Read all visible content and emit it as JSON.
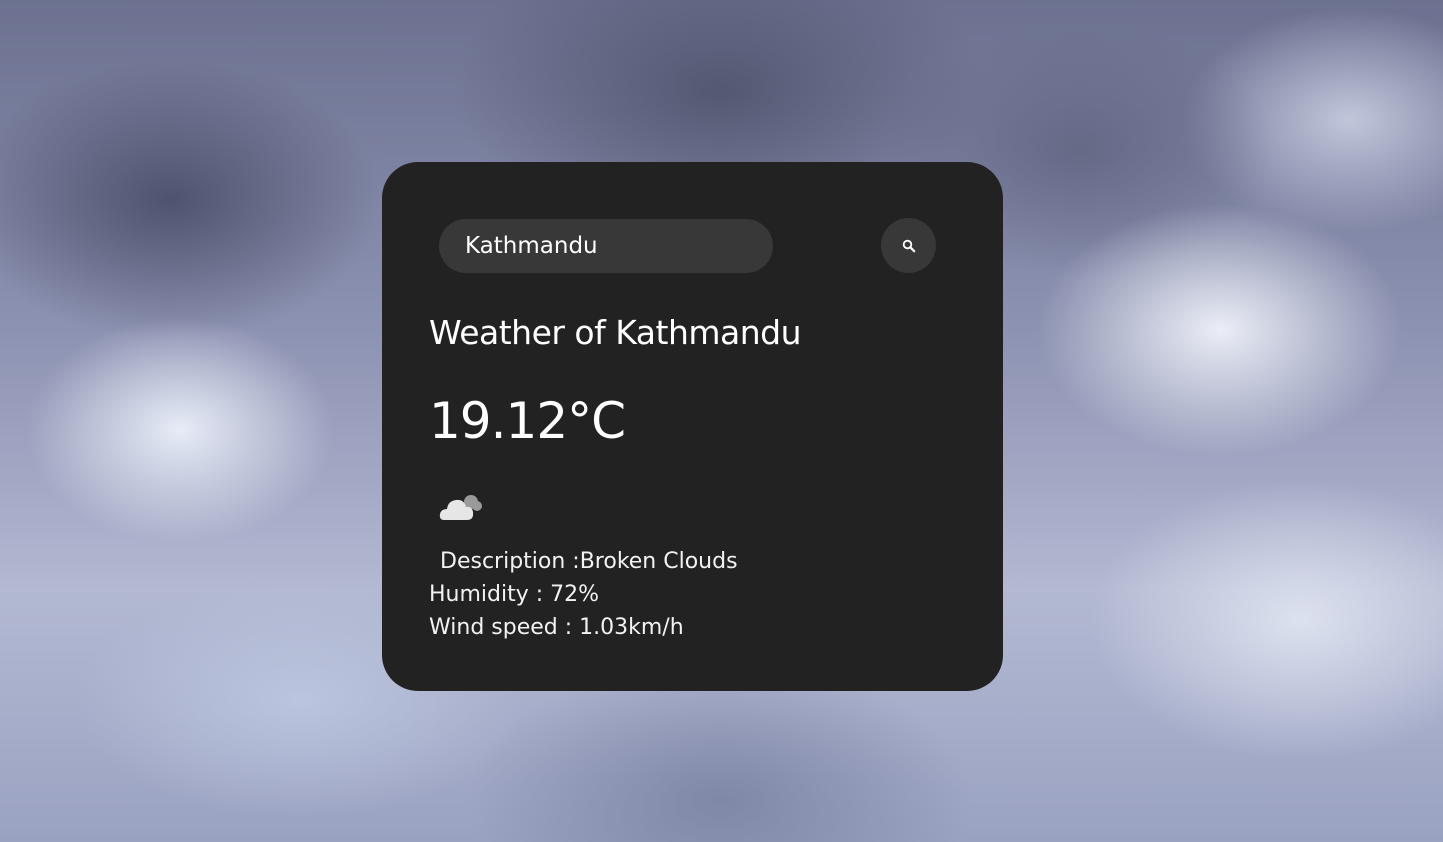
{
  "search": {
    "value": "Kathmandu",
    "button_icon": "search-icon"
  },
  "weather": {
    "title": "Weather of Kathmandu",
    "temperature": "19.12°C",
    "condition_icon": "cloud-icon",
    "description": "Description :Broken Clouds",
    "humidity": "Humidity : 72%",
    "wind_speed": "Wind speed : 1.03km/h"
  },
  "colors": {
    "card_background": "#222222",
    "input_background": "#383838",
    "text": "#ffffff"
  }
}
